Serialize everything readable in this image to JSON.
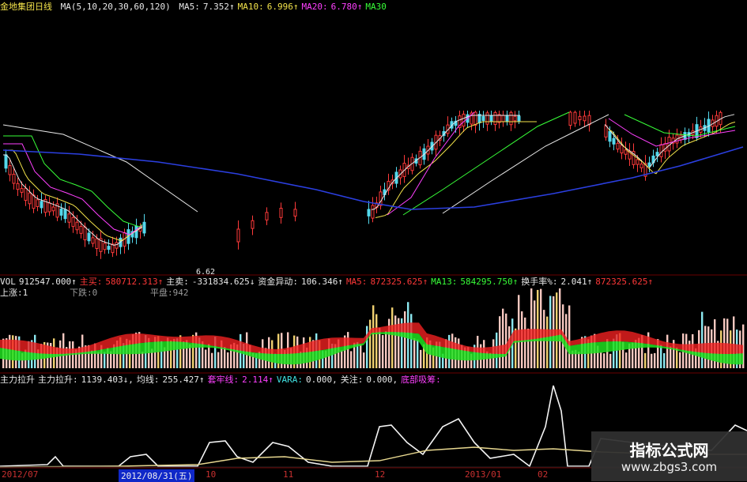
{
  "main_header": {
    "stock": "金地集团日线",
    "ma_params": "MA(5,10,20,30,60,120)",
    "items": [
      {
        "label": "MA5:",
        "value": "7.352↑",
        "color": "white"
      },
      {
        "label": "MA10:",
        "value": "6.996↑",
        "color": "yellow"
      },
      {
        "label": "MA20:",
        "value": "6.780↑",
        "color": "magenta"
      },
      {
        "label": "MA30",
        "value": "",
        "color": "green"
      }
    ]
  },
  "main_chart": {
    "low_label": "6.62"
  },
  "vol_header": {
    "items": [
      {
        "text": "VOL",
        "color": "white"
      },
      {
        "text": "912547.000↑",
        "color": "white"
      },
      {
        "text": "主买:",
        "color": "red"
      },
      {
        "text": "580712.313↑",
        "color": "red"
      },
      {
        "text": "主卖:",
        "color": "white"
      },
      {
        "text": "-331834.625↓",
        "color": "white"
      },
      {
        "text": "资金异动:",
        "color": "white"
      },
      {
        "text": "106.346↑",
        "color": "white"
      },
      {
        "text": "MA5:",
        "color": "red"
      },
      {
        "text": "872325.625↑",
        "color": "red"
      },
      {
        "text": "MA13:",
        "color": "green"
      },
      {
        "text": "584295.750↑",
        "color": "green"
      },
      {
        "text": "换手率%:",
        "color": "white"
      },
      {
        "text": "2.041↑",
        "color": "white"
      },
      {
        "text": "872325.625↑",
        "color": "red"
      }
    ],
    "sub_items": [
      {
        "text": "上涨:1",
        "color": "white"
      },
      {
        "text": "下跌:0",
        "color": "gray"
      },
      {
        "text": "平盘:942",
        "color": "gray"
      }
    ]
  },
  "ind_header": {
    "items": [
      {
        "text": "主力拉升",
        "color": "white"
      },
      {
        "text": "主力拉升:",
        "color": "white"
      },
      {
        "text": "1139.403↓,",
        "color": "white"
      },
      {
        "text": "均线:",
        "color": "white"
      },
      {
        "text": "255.427↑",
        "color": "white"
      },
      {
        "text": "套牢线:",
        "color": "magenta"
      },
      {
        "text": "2.114↑",
        "color": "magenta"
      },
      {
        "text": "VARA:",
        "color": "cyan"
      },
      {
        "text": "0.000,",
        "color": "white"
      },
      {
        "text": "关注:",
        "color": "white"
      },
      {
        "text": "0.000,",
        "color": "white"
      },
      {
        "text": "底部吸筹:",
        "color": "magenta"
      }
    ]
  },
  "xaxis": {
    "labels": [
      {
        "text": "2012/07",
        "selected": false
      },
      {
        "text": "2012/08/31(五)",
        "selected": true
      },
      {
        "text": "10",
        "selected": false
      },
      {
        "text": "11",
        "selected": false
      },
      {
        "text": "12",
        "selected": false
      },
      {
        "text": "2013/01",
        "selected": false
      },
      {
        "text": "02",
        "selected": false
      }
    ]
  },
  "watermark": {
    "title": "指标公式网",
    "url": "www.zbgs3.com"
  },
  "colors": {
    "background": "#000000",
    "up": "#ff3a3a",
    "down": "#54d8ec",
    "ma5": "#e8e8e8",
    "ma10": "#f2e24a",
    "ma20": "#ff40ff",
    "ma30": "#38ff38",
    "ma60": "#2b3fe0",
    "grid": "#6a0000",
    "vol_bar_up": "#f7c8c0",
    "vol_bar_hl": "#f0d070",
    "vol_bar_down": "#8ce8f0",
    "ind_main": "#f4f4f4",
    "ind_avg": "#e8d890"
  }
}
